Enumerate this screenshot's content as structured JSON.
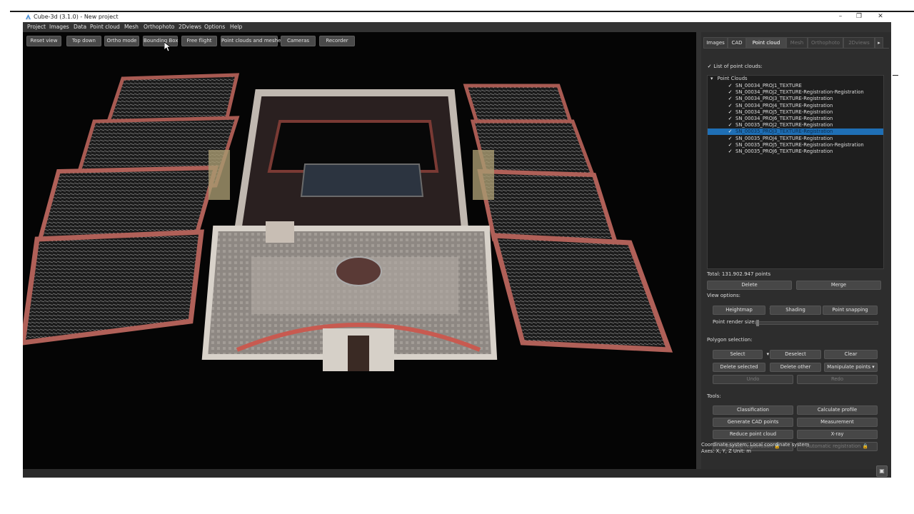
{
  "window": {
    "title": "Cube-3d (3.1.0) - New project",
    "controls": [
      "–",
      "❐",
      "✕"
    ]
  },
  "menu": [
    "Project",
    "Images",
    "Data",
    "Point cloud",
    "Mesh",
    "Orthophoto",
    "2Dviews",
    "Options",
    "Help"
  ],
  "viewport": {
    "buttons": [
      "Reset view",
      "Top down",
      "Ortho mode",
      "Bounding Box",
      "Free flight",
      "Point clouds and meshes",
      "Cameras",
      "Recorder"
    ]
  },
  "panel": {
    "tabs": [
      {
        "label": "Images",
        "state": "normal"
      },
      {
        "label": "CAD",
        "state": "normal"
      },
      {
        "label": "Point cloud",
        "state": "active"
      },
      {
        "label": "Mesh",
        "state": "disabled"
      },
      {
        "label": "Orthophoto",
        "state": "disabled"
      },
      {
        "label": "2Dviews",
        "state": "disabled"
      }
    ],
    "tab_scroll": "▸",
    "list_header": "List of point clouds:",
    "tree_root": "Point Clouds",
    "tree_items": [
      "SN_00034_PROJ1_TEXTURE",
      "SN_00034_PROJ2_TEXTURE-Registration-Registration",
      "SN_00034_PROJ3_TEXTURE-Registration",
      "SN_00034_PROJ4_TEXTURE-Registration",
      "SN_00034_PROJ5_TEXTURE-Registration",
      "SN_00034_PROJ6_TEXTURE-Registration",
      "SN_00035_PROJ2_TEXTURE-Registration",
      "SN_00035_PROJ3_TEXTURE-Registration",
      "SN_00035_PROJ4_TEXTURE-Registration",
      "SN_00035_PROJ5_TEXTURE-Registration-Registration",
      "SN_00035_PROJ6_TEXTURE-Registration"
    ],
    "selected_index": 7,
    "total": "Total: 131.902.947 points",
    "delete": "Delete",
    "merge": "Merge",
    "view_options_label": "View options:",
    "heightmap": "Heightmap",
    "shading": "Shading",
    "point_snapping": "Point snapping",
    "render_size_label": "Point render size:",
    "render_size_value": 0.02,
    "polygon_label": "Polygon selection:",
    "select": "Select",
    "deselect": "Deselect",
    "clear": "Clear",
    "delete_selected": "Delete selected",
    "delete_other": "Delete other",
    "manipulate_points": "Manipulate points",
    "undo": "Undo",
    "redo": "Redo",
    "tools_label": "Tools:",
    "classification": "Classification",
    "calculate_profile": "Calculate profile",
    "generate_cad": "Generate CAD points",
    "measurement": "Measurement",
    "reduce": "Reduce point cloud",
    "xray": "X-ray",
    "manual_reg": "Manual registration",
    "auto_reg": "Automatic registration",
    "coord_system": "Coordinate system: Local coordinate system",
    "axes": "Axes: X, Y, Z Unit: m"
  },
  "colors": {
    "selection": "#1f6fb5",
    "panel": "#2d2d2d",
    "viewport": "#050505"
  }
}
